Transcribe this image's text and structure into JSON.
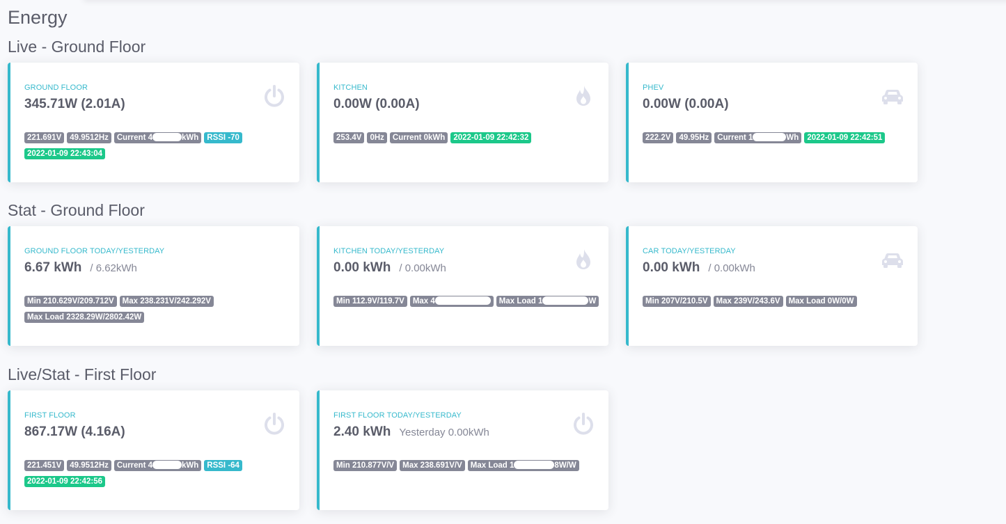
{
  "page_title": "Energy",
  "accent_colors": {
    "primary": "#36b9cc",
    "success": "#1cc88a",
    "secondary": "#858796",
    "icon": "#dddfeb"
  },
  "sections": [
    {
      "title": "Live - Ground Floor"
    },
    {
      "title": "Stat - Ground Floor"
    },
    {
      "title": "Live/Stat - First Floor"
    }
  ],
  "cards": [
    {
      "label": "GROUND FLOOR",
      "value": "345.71W (2.01A)",
      "sub": "",
      "icon": "power-icon",
      "badges": [
        {
          "text": "221.691V",
          "variant": "secondary"
        },
        {
          "text": "49.9512Hz",
          "variant": "secondary"
        },
        {
          "pre": "Current 4",
          "post": "kWh",
          "variant": "secondary",
          "redacted": true
        },
        {
          "text": "RSSI -70",
          "variant": "info"
        },
        {
          "text": "2022-01-09 22:43:04",
          "variant": "success"
        }
      ]
    },
    {
      "label": "KITCHEN",
      "value": "0.00W (0.00A)",
      "sub": "",
      "icon": "fire-icon",
      "badges": [
        {
          "text": "253.4V",
          "variant": "secondary"
        },
        {
          "text": "0Hz",
          "variant": "secondary"
        },
        {
          "text": "Current 0kWh",
          "variant": "secondary"
        },
        {
          "text": "2022-01-09 22:42:32",
          "variant": "success"
        }
      ]
    },
    {
      "label": "PHEV",
      "value": "0.00W (0.00A)",
      "sub": "",
      "icon": "car-icon",
      "badges": [
        {
          "text": "222.2V",
          "variant": "secondary"
        },
        {
          "text": "49.95Hz",
          "variant": "secondary"
        },
        {
          "pre": "Current 1",
          "post": "Wh",
          "variant": "secondary",
          "redacted": true
        },
        {
          "text": "2022-01-09 22:42:51",
          "variant": "success"
        }
      ]
    },
    {
      "label": "GROUND FLOOR TODAY/YESTERDAY",
      "value": "6.67 kWh",
      "sub": "/ 6.62kWh",
      "icon": "",
      "badges": [
        {
          "text": "Min 210.629V/209.712V",
          "variant": "secondary"
        },
        {
          "text": "Max 238.231V/242.292V",
          "variant": "secondary"
        },
        {
          "text": "Max Load 2328.29W/2802.42W",
          "variant": "secondary"
        }
      ]
    },
    {
      "label": "KITCHEN TODAY/YESTERDAY",
      "value": "0.00 kWh",
      "sub": "/ 0.00kWh",
      "icon": "fire-icon",
      "badges": [
        {
          "text": "Min 112.9V/119.7V",
          "variant": "secondary"
        },
        {
          "pre": "Max 4",
          "post": "",
          "variant": "secondary",
          "redacted": true
        },
        {
          "pre": "Max Load 1",
          "post": "W",
          "variant": "secondary",
          "redacted": true
        }
      ]
    },
    {
      "label": "CAR TODAY/YESTERDAY",
      "value": "0.00 kWh",
      "sub": "/ 0.00kWh",
      "icon": "car-icon",
      "badges": [
        {
          "text": "Min 207V/210.5V",
          "variant": "secondary"
        },
        {
          "text": "Max 239V/243.6V",
          "variant": "secondary"
        },
        {
          "text": "Max Load 0W/0W",
          "variant": "secondary"
        }
      ]
    },
    {
      "label": "FIRST FLOOR",
      "value": "867.17W (4.16A)",
      "sub": "",
      "icon": "power-icon",
      "badges": [
        {
          "text": "221.451V",
          "variant": "secondary"
        },
        {
          "text": "49.9512Hz",
          "variant": "secondary"
        },
        {
          "pre": "Current 4",
          "post": "kWh",
          "variant": "secondary",
          "redacted": true
        },
        {
          "text": "RSSI -64",
          "variant": "info"
        },
        {
          "text": "2022-01-09 22:42:56",
          "variant": "success"
        }
      ]
    },
    {
      "label": "FIRST FLOOR TODAY/YESTERDAY",
      "value": "2.40 kWh",
      "sub": "Yesterday 0.00kWh",
      "icon": "power-icon",
      "badges": [
        {
          "text": "Min 210.877V/V",
          "variant": "secondary"
        },
        {
          "text": "Max 238.691V/V",
          "variant": "secondary"
        },
        {
          "pre": "Max Load 1",
          "post": "8W/W",
          "variant": "secondary",
          "redacted": true
        }
      ]
    }
  ]
}
